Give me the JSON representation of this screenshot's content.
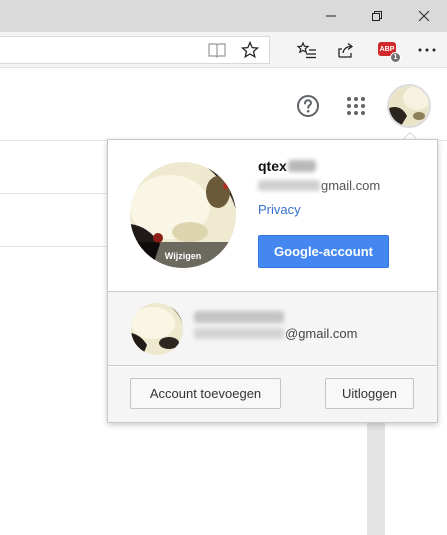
{
  "window": {
    "minimize_icon": "minimize-icon",
    "maximize_icon": "restore-icon",
    "close_icon": "close-icon"
  },
  "toolbar": {
    "reading_view_icon": "book-icon",
    "favorite_icon": "star-icon",
    "favorites_hub_icon": "favorites-list-icon",
    "share_icon": "share-icon",
    "abp": {
      "label": "ABP",
      "count": "1"
    },
    "more_icon": "more-icon"
  },
  "header": {
    "help_icon": "help-icon",
    "apps_icon": "apps-grid-icon"
  },
  "account": {
    "name": "qtex",
    "email_suffix": "gmail.com",
    "privacy_link": "Privacy",
    "change_label": "Wijzigen",
    "account_button": "Google-account"
  },
  "other_account": {
    "email_suffix": "@gmail.com"
  },
  "footer": {
    "add_account": "Account toevoegen",
    "logout": "Uitloggen"
  },
  "colors": {
    "accent": "#4487f0",
    "link": "#3670cc",
    "abp_red": "#d0282b"
  }
}
